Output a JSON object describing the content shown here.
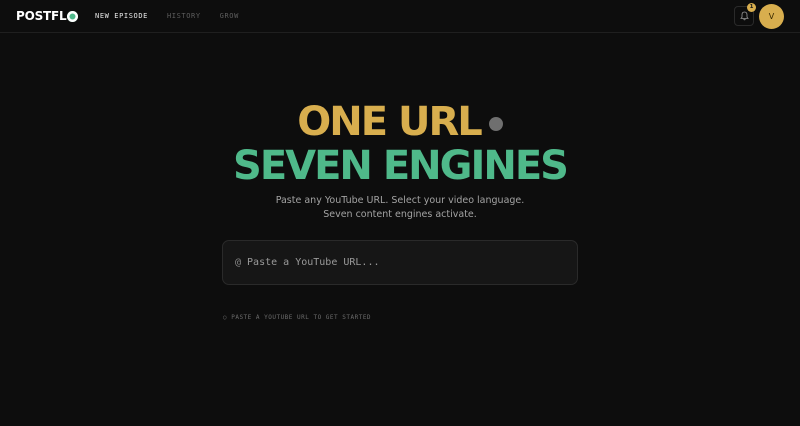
{
  "header": {
    "logo_text": "POSTFL",
    "nav": [
      {
        "label": "NEW EPISODE",
        "active": true
      },
      {
        "label": "HISTORY",
        "active": false
      },
      {
        "label": "GROW",
        "active": false
      }
    ],
    "notification_count": "1",
    "avatar_initial": "V"
  },
  "hero": {
    "line1": "ONE URL",
    "line2": "SEVEN ENGINES",
    "subtitle": "Paste any YouTube URL. Select your video language. Seven content engines activate."
  },
  "url_input": {
    "icon": "@",
    "placeholder": "Paste a YouTube URL...",
    "value": ""
  },
  "hint": "○ PASTE A YOUTUBE URL TO GET STARTED",
  "colors": {
    "gold": "#d8ae4e",
    "green": "#4fb98a",
    "background": "#0d0d0d"
  }
}
